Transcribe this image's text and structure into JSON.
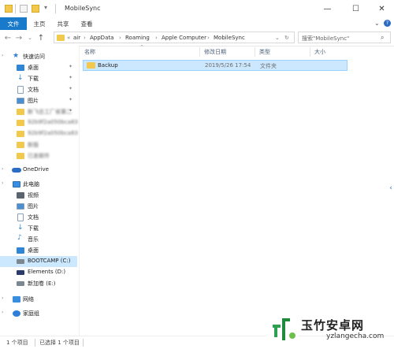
{
  "window": {
    "title": "MobileSync",
    "controls": {
      "minimize": "—",
      "maximize": "☐",
      "close": "✕"
    }
  },
  "ribbon": {
    "tabs": [
      "文件",
      "主页",
      "共享",
      "查看"
    ],
    "collapse_icon": "chevron-down",
    "help_icon": "help"
  },
  "address": {
    "overflow": "«",
    "crumbs": [
      "air",
      "AppData",
      "Roaming",
      "Apple Computer",
      "MobileSync"
    ],
    "search_placeholder": "搜索\"MobileSync\""
  },
  "sidebar": {
    "quick_access": "快速访问",
    "quick_items": [
      {
        "label": "桌面",
        "pinned": true
      },
      {
        "label": "下载",
        "pinned": true
      },
      {
        "label": "文档",
        "pinned": true
      },
      {
        "label": "图片",
        "pinned": true
      },
      {
        "label": "新飞总工厂省第二",
        "pinned": true
      },
      {
        "label": "92b9f2a050bca83",
        "pinned": false
      },
      {
        "label": "92b9f2a050bca83",
        "pinned": false
      },
      {
        "label": "新版",
        "pinned": false
      },
      {
        "label": "已发邮件",
        "pinned": false
      }
    ],
    "onedrive": "OneDrive",
    "this_pc": "此电脑",
    "pc_items": [
      "视频",
      "图片",
      "文档",
      "下载",
      "音乐",
      "桌面",
      "BOOTCAMP (C:)",
      "Elements (D:)",
      "新加卷 (E:)"
    ],
    "network": "网络",
    "homegroup": "家庭组"
  },
  "columns": {
    "name": "名称",
    "date": "修改日期",
    "type": "类型",
    "size": "大小"
  },
  "files": [
    {
      "name": "Backup",
      "date": "2019/5/26 17:54",
      "type": "文件夹",
      "size": ""
    }
  ],
  "status": {
    "count": "1 个项目",
    "selected": "已选择 1 个项目"
  },
  "watermark": {
    "title": "玉竹安卓网",
    "url": "yzlangecha.com"
  },
  "colors": {
    "accent": "#1979ca",
    "selection": "#cce8ff",
    "folder": "#f2c94c"
  }
}
